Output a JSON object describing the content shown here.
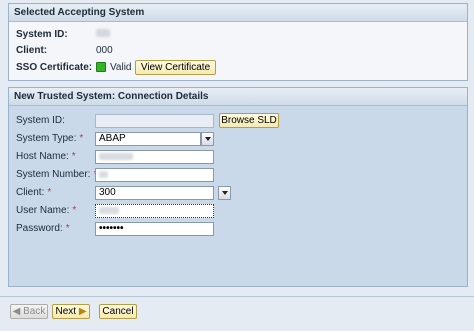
{
  "accepting": {
    "header": "Selected Accepting System",
    "system_id_label": "System ID:",
    "client_label": "Client:",
    "client_value": "000",
    "sso_label": "SSO Certificate:",
    "sso_status": "Valid",
    "view_certificate": "View Certificate"
  },
  "trusted": {
    "header": "New Trusted System: Connection Details",
    "system_id_label": "System ID:",
    "browse_sld": "Browse SLD",
    "system_type_label": "System Type:",
    "system_type_value": "ABAP",
    "host_name_label": "Host Name:",
    "system_number_label": "System Number:",
    "client_label": "Client:",
    "client_value": "300",
    "user_name_label": "User Name:",
    "password_label": "Password:",
    "password_value": "•••••••",
    "required_marker": "*"
  },
  "footer": {
    "back": "Back",
    "next": "Next",
    "cancel": "Cancel"
  }
}
